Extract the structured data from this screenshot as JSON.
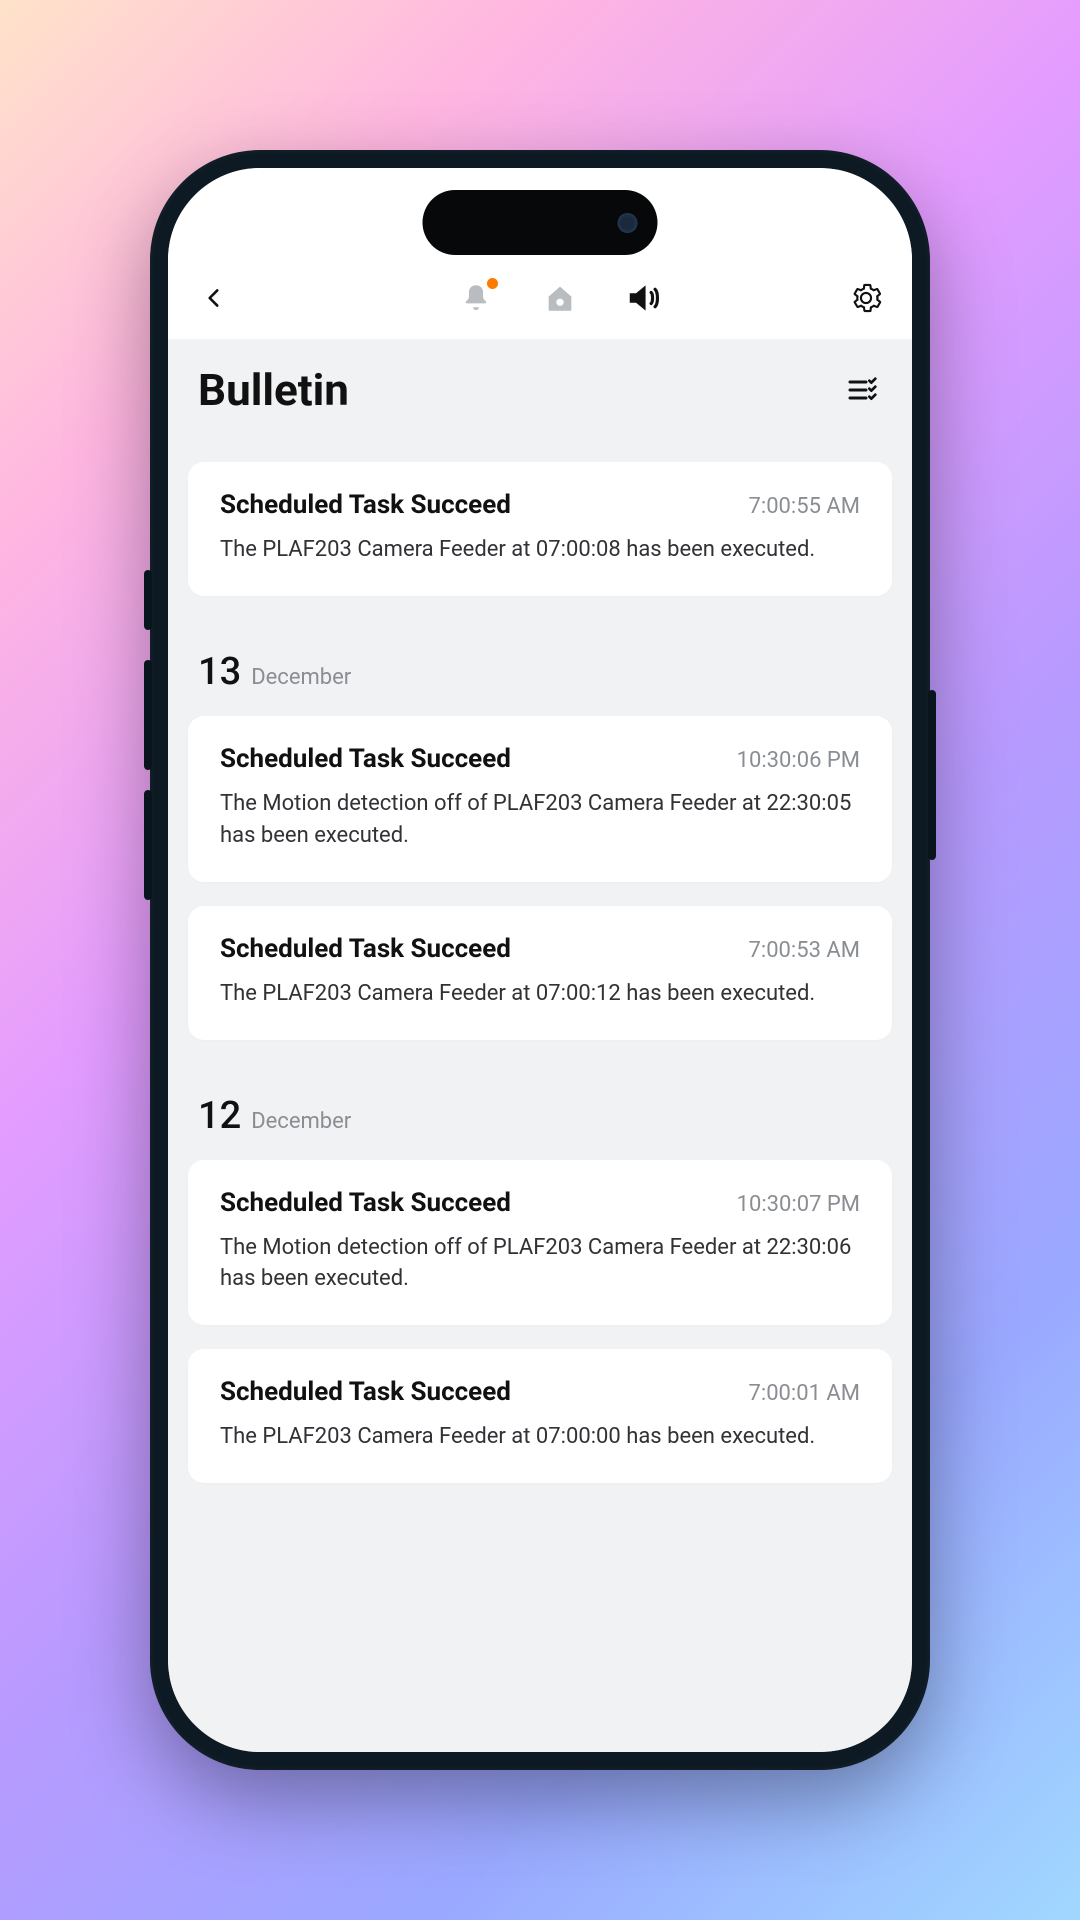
{
  "header": {
    "page_title": "Bulletin",
    "icons": {
      "back": "chevron-left",
      "bell": "bell",
      "home": "home",
      "speaker": "speaker",
      "gear": "gear",
      "filter": "checklist"
    },
    "bell_has_badge": true,
    "active_tab": "speaker"
  },
  "groups": [
    {
      "day": "",
      "month": "",
      "show_date": false,
      "items": [
        {
          "title": "Scheduled Task Succeed",
          "time": "7:00:55 AM",
          "body": "The PLAF203 Camera Feeder at 07:00:08 has been executed."
        }
      ]
    },
    {
      "day": "13",
      "month": "December",
      "show_date": true,
      "items": [
        {
          "title": "Scheduled Task Succeed",
          "time": "10:30:06 PM",
          "body": "The Motion detection off of PLAF203 Camera Feeder at 22:30:05 has been executed."
        },
        {
          "title": "Scheduled Task Succeed",
          "time": "7:00:53 AM",
          "body": "The PLAF203 Camera Feeder at 07:00:12 has been executed."
        }
      ]
    },
    {
      "day": "12",
      "month": "December",
      "show_date": true,
      "items": [
        {
          "title": "Scheduled Task Succeed",
          "time": "10:30:07 PM",
          "body": "The Motion detection off of PLAF203 Camera Feeder at 22:30:06 has been executed."
        },
        {
          "title": "Scheduled Task Succeed",
          "time": "7:00:01 AM",
          "body": "The PLAF203 Camera Feeder at 07:00:00 has been executed."
        }
      ]
    }
  ],
  "colors": {
    "badge": "#ff7a00",
    "inactive_icon": "#b9bcc1",
    "active_icon": "#111111",
    "bg": "#f1f2f4"
  }
}
